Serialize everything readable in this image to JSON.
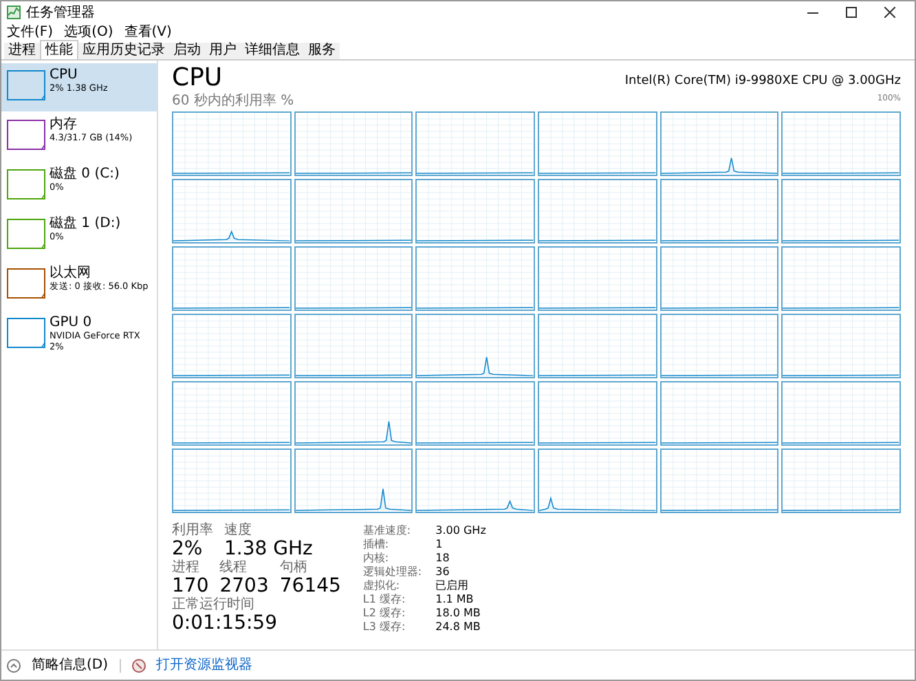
{
  "window": {
    "title": "任务管理器"
  },
  "menu": [
    "文件(F)",
    "选项(O)",
    "查看(V)"
  ],
  "tabs": [
    {
      "label": "进程",
      "selected": false
    },
    {
      "label": "性能",
      "selected": true
    },
    {
      "label": "应用历史记录",
      "selected": false
    },
    {
      "label": "启动",
      "selected": false
    },
    {
      "label": "用户",
      "selected": false
    },
    {
      "label": "详细信息",
      "selected": false
    },
    {
      "label": "服务",
      "selected": false
    }
  ],
  "sidebar": {
    "items": [
      {
        "title": "CPU",
        "subtitle": "2% 1.38 GHz",
        "color": "#1188cc",
        "selected": true
      },
      {
        "title": "内存",
        "subtitle": "4.3/31.7 GB (14%)",
        "color": "#8b2fa8",
        "selected": false
      },
      {
        "title": "磁盘 0 (C:)",
        "subtitle": "0%",
        "color": "#4da60c",
        "selected": false
      },
      {
        "title": "磁盘 1 (D:)",
        "subtitle": "0%",
        "color": "#4da60c",
        "selected": false
      },
      {
        "title": "以太网",
        "subtitle": "发送: 0 接收: 56.0 Kbp",
        "color": "#a74f01",
        "selected": false
      },
      {
        "title": "GPU 0",
        "subtitle": "NVIDIA GeForce RTX",
        "subtitle2": "2%",
        "color": "#1188cc",
        "selected": false
      }
    ]
  },
  "header": {
    "title": "CPU",
    "model": "Intel(R) Core(TM) i9-9980XE CPU @ 3.00GHz",
    "graph_caption": "60 秒内的利用率 %",
    "graph_max": "100%"
  },
  "stats": {
    "rows": [
      [
        {
          "label": "利用率",
          "value": "2%"
        },
        {
          "label": "速度",
          "value": "1.38 GHz"
        }
      ],
      [
        {
          "label": "进程",
          "value": "170"
        },
        {
          "label": "线程",
          "value": "2703"
        },
        {
          "label": "句柄",
          "value": "76145"
        }
      ],
      [
        {
          "label": "正常运行时间",
          "value": "0:01:15:59"
        }
      ]
    ]
  },
  "details": [
    {
      "key": "基准速度:",
      "value": "3.00 GHz"
    },
    {
      "key": "插槽:",
      "value": "1"
    },
    {
      "key": "内核:",
      "value": "18"
    },
    {
      "key": "逻辑处理器:",
      "value": "36"
    },
    {
      "key": "虚拟化:",
      "value": "已启用"
    },
    {
      "key": "L1 缓存:",
      "value": "1.1 MB"
    },
    {
      "key": "L2 缓存:",
      "value": "18.0 MB"
    },
    {
      "key": "L3 缓存:",
      "value": "24.8 MB"
    }
  ],
  "footer": {
    "less": "简略信息(D)",
    "monitor": "打开资源监视器"
  }
}
